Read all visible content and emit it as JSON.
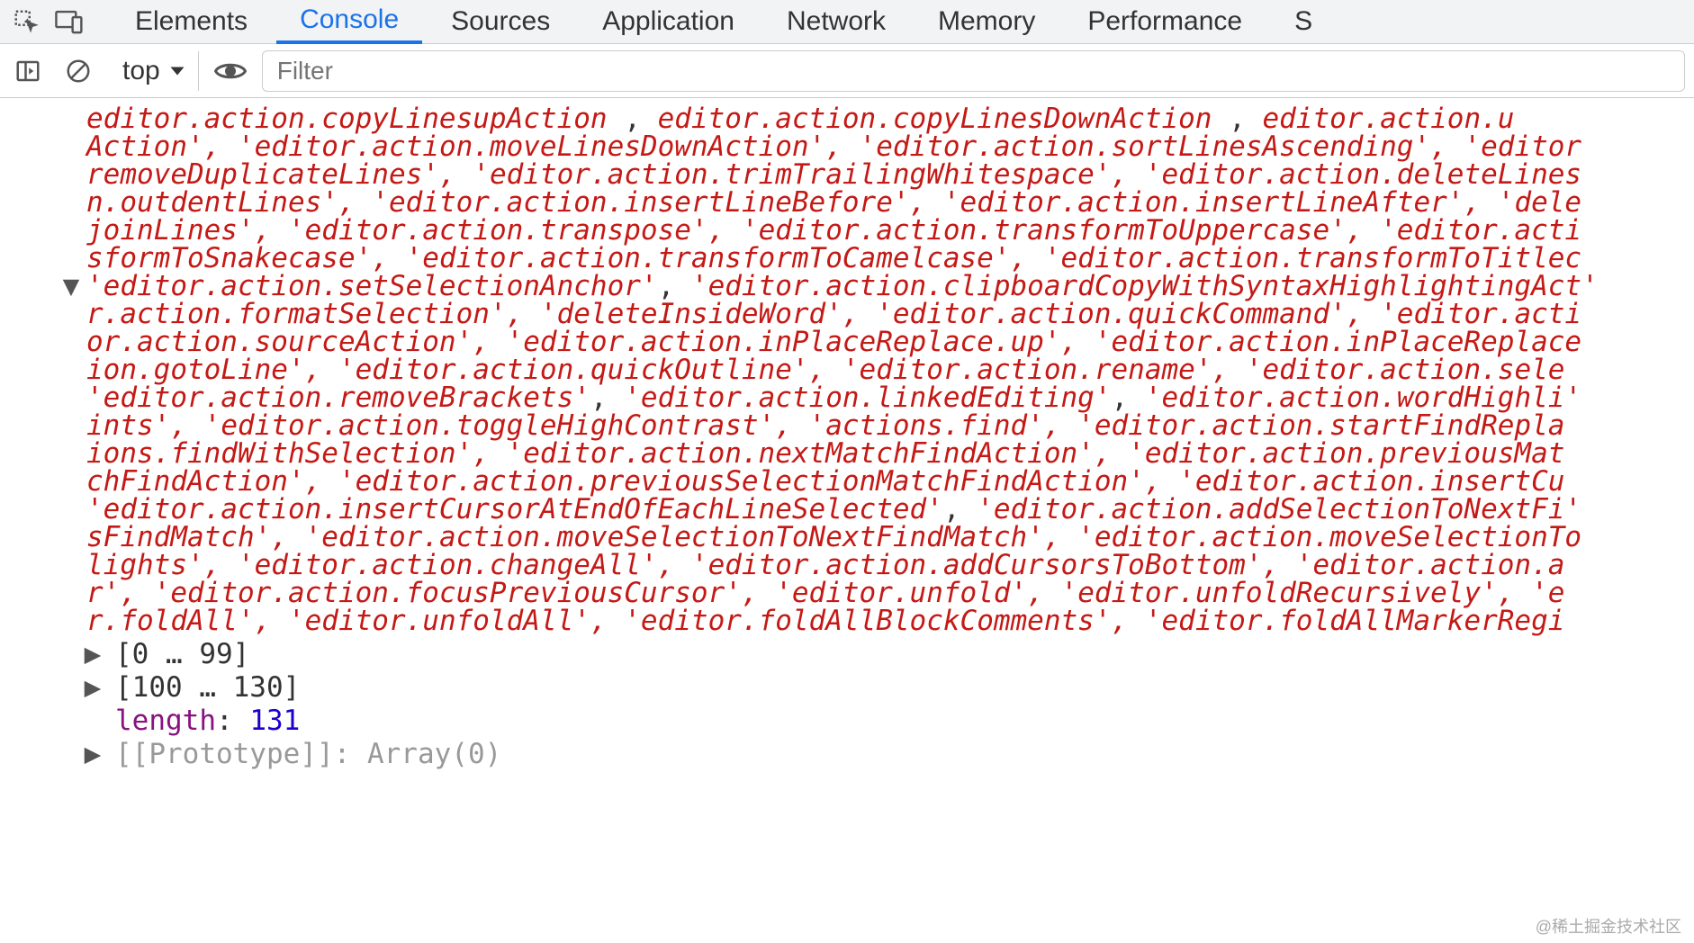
{
  "tabs": {
    "elements": "Elements",
    "console": "Console",
    "sources": "Sources",
    "application": "Application",
    "network": "Network",
    "memory": "Memory",
    "performance": "Performance",
    "more": "S"
  },
  "toolbar": {
    "context": "top",
    "filter_placeholder": "Filter"
  },
  "console_lines": [
    "editor.action.copyLinesupAction , editor.action.copyLinesDownAction , editor.action.u",
    "Action', 'editor.action.moveLinesDownAction', 'editor.action.sortLinesAscending', 'editor",
    "removeDuplicateLines', 'editor.action.trimTrailingWhitespace', 'editor.action.deleteLines",
    "n.outdentLines', 'editor.action.insertLineBefore', 'editor.action.insertLineAfter', 'dele",
    "joinLines', 'editor.action.transpose', 'editor.action.transformToUppercase', 'editor.acti",
    "sformToSnakecase', 'editor.action.transformToCamelcase', 'editor.action.transformToTitlec",
    "'editor.action.setSelectionAnchor', 'editor.action.clipboardCopyWithSyntaxHighlightingAct",
    "r.action.formatSelection', 'deleteInsideWord', 'editor.action.quickCommand', 'editor.acti",
    "or.action.sourceAction', 'editor.action.inPlaceReplace.up', 'editor.action.inPlaceReplace",
    "ion.gotoLine', 'editor.action.quickOutline', 'editor.action.rename', 'editor.action.sele",
    "'editor.action.removeBrackets', 'editor.action.linkedEditing', 'editor.action.wordHighli",
    "ints', 'editor.action.toggleHighContrast', 'actions.find', 'editor.action.startFindRepla",
    "ions.findWithSelection', 'editor.action.nextMatchFindAction', 'editor.action.previousMat",
    "chFindAction', 'editor.action.previousSelectionMatchFindAction', 'editor.action.insertCu",
    "'editor.action.insertCursorAtEndOfEachLineSelected', 'editor.action.addSelectionToNextFi",
    "sFindMatch', 'editor.action.moveSelectionToNextFindMatch', 'editor.action.moveSelectionTo",
    "lights', 'editor.action.changeAll', 'editor.action.addCursorsToBottom', 'editor.action.a",
    "r', 'editor.action.focusPreviousCursor', 'editor.unfold', 'editor.unfoldRecursively', 'e",
    "r.foldAll', 'editor.unfoldAll', 'editor.foldAllBlockComments', 'editor.foldAllMarkerRegi"
  ],
  "props": {
    "range1": "[0 … 99]",
    "range2": "[100 … 130]",
    "length_key": "length",
    "length_val": "131",
    "proto_key": "[[Prototype]]",
    "proto_val": "Array(0)"
  },
  "watermark": "@稀土掘金技术社区"
}
